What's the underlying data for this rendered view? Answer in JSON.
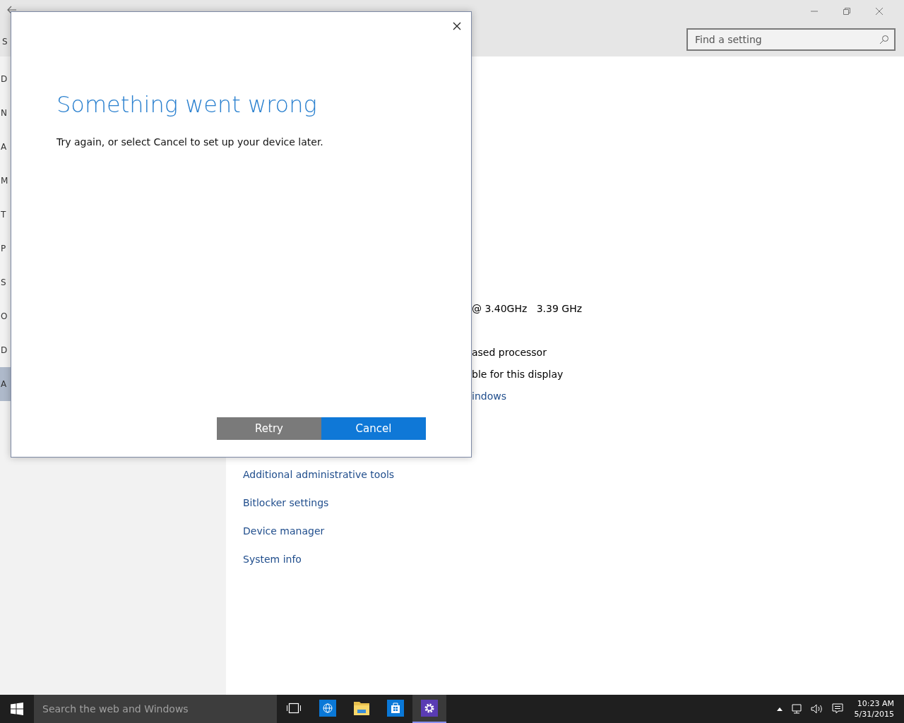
{
  "window": {
    "controls": [
      {
        "kind": "minimize"
      },
      {
        "kind": "restore"
      },
      {
        "kind": "close"
      }
    ]
  },
  "sidebar": {
    "heading": "S",
    "items": [
      {
        "label": "D",
        "selected": false
      },
      {
        "label": "N",
        "selected": false
      },
      {
        "label": "A",
        "selected": false
      },
      {
        "label": "M",
        "selected": false
      },
      {
        "label": "T",
        "selected": false
      },
      {
        "label": "P",
        "selected": false
      },
      {
        "label": "S",
        "selected": false
      },
      {
        "label": "O",
        "selected": false
      },
      {
        "label": "D",
        "selected": false
      },
      {
        "label": "A",
        "selected": true
      }
    ]
  },
  "search": {
    "placeholder": "Find a setting"
  },
  "content": {
    "lines": [
      {
        "kind": "text",
        "text": "@ 3.40GHz   3.39 GHz"
      },
      {
        "kind": "gap"
      },
      {
        "kind": "text",
        "text": "ased processor"
      },
      {
        "kind": "text",
        "text": "ble for this display"
      },
      {
        "kind": "link",
        "text": "indows"
      }
    ],
    "links": [
      "Additional administrative tools",
      "Bitlocker settings",
      "Device manager",
      "System info"
    ]
  },
  "dialog": {
    "title": "Something went wrong",
    "message": "Try again, or select Cancel to set up your device later.",
    "buttons": [
      {
        "label": "Retry",
        "kind": "secondary"
      },
      {
        "label": "Cancel",
        "kind": "primary"
      }
    ]
  },
  "taskbar": {
    "search_placeholder": "Search the web and Windows",
    "apps": [
      {
        "kind": "taskview",
        "active": false
      },
      {
        "kind": "browser",
        "active": false
      },
      {
        "kind": "folder",
        "active": false
      },
      {
        "kind": "store",
        "active": false
      },
      {
        "kind": "settings",
        "active": true
      }
    ],
    "time": "10:23 AM",
    "date": "5/31/2015"
  }
}
